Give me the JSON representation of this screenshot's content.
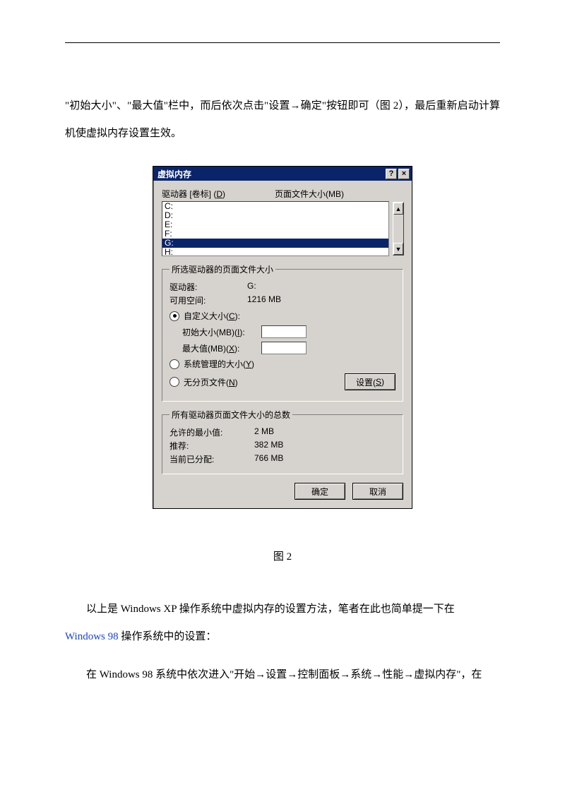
{
  "paragraphs": {
    "p1": "\"初始大小\"、\"最大值\"栏中，而后依次点击\"设置→确定\"按钮即可（图 2），最后重新启动计算机使虚拟内存设置生效。",
    "figcaption": "图  2",
    "p2a": "以上是 Windows XP 操作系统中虚拟内存的设置方法，笔者在此也简单提一下在",
    "p2link": "Windows 98",
    "p2b": " 操作系统中的设置：",
    "p3": "在 Windows 98 系统中依次进入\"开始→设置→控制面板→系统→性能→虚拟内存\"，在"
  },
  "dialog": {
    "title": "虚拟内存",
    "help_btn": "?",
    "close_btn": "×",
    "list": {
      "col_drive_pre": "驱动器  [卷标] (",
      "col_drive_u": "D",
      "col_drive_post": ")",
      "col_size": "页面文件大小(MB)",
      "items": [
        {
          "label": "C:",
          "selected": false
        },
        {
          "label": "D:",
          "selected": false
        },
        {
          "label": "E:",
          "selected": false
        },
        {
          "label": "F:",
          "selected": false
        },
        {
          "label": "G:",
          "selected": true
        },
        {
          "label": "H:",
          "selected": false
        }
      ],
      "scroll_up": "▲",
      "scroll_down": "▼"
    },
    "selected_group": {
      "legend": "所选驱动器的页面文件大小",
      "drive_label": "驱动器:",
      "drive_value": "G:",
      "free_label": "可用空间:",
      "free_value": "1216 MB",
      "radio_custom_pre": "自定义大小(",
      "radio_custom_u": "C",
      "radio_custom_post": "):",
      "init_label_pre": "初始大小(MB)(",
      "init_label_u": "I",
      "init_label_post": "):",
      "init_value": "",
      "max_label_pre": "最大值(MB)(",
      "max_label_u": "X",
      "max_label_post": "):",
      "max_value": "",
      "radio_sys_pre": "系统管理的大小(",
      "radio_sys_u": "Y",
      "radio_sys_post": ")",
      "radio_none_pre": "无分页文件(",
      "radio_none_u": "N",
      "radio_none_post": ")",
      "set_btn_pre": "设置(",
      "set_btn_u": "S",
      "set_btn_post": ")"
    },
    "totals_group": {
      "legend": "所有驱动器页面文件大小的总数",
      "min_label": "允许的最小值:",
      "min_value": "2 MB",
      "rec_label": "推荐:",
      "rec_value": "382 MB",
      "cur_label": "当前已分配:",
      "cur_value": "766 MB"
    },
    "ok_btn": "确定",
    "cancel_btn": "取消"
  }
}
